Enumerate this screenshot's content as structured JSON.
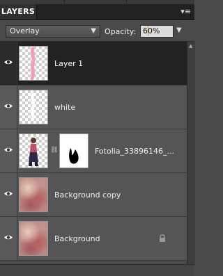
{
  "panel": {
    "title": "LAYERS",
    "menu_icon": "panel-menu-icon"
  },
  "options": {
    "blend_mode": "Overlay",
    "opacity_label": "Opacity:",
    "opacity_value": "60%"
  },
  "layers": [
    {
      "name": "Layer 1",
      "selected": true,
      "visible": true,
      "thumb": "pink-stroke-on-transparent",
      "locked": false
    },
    {
      "name": "white",
      "selected": false,
      "visible": true,
      "thumb": "white-stroke-on-transparent",
      "locked": false
    },
    {
      "name": "Fotolia_33896146_...",
      "selected": false,
      "visible": true,
      "thumb": "person-with-mask",
      "has_mask": true,
      "locked": false
    },
    {
      "name": "Background copy",
      "selected": false,
      "visible": true,
      "thumb": "cloud-texture",
      "locked": false
    },
    {
      "name": "Background",
      "selected": false,
      "visible": true,
      "thumb": "cloud-texture",
      "locked": true
    }
  ]
}
